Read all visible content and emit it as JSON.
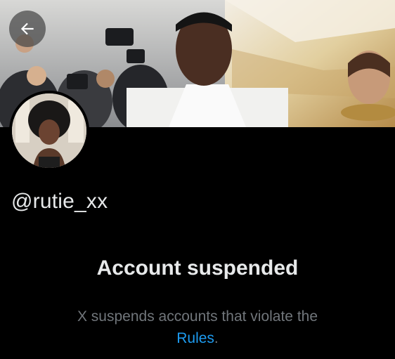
{
  "banner": {
    "description_icon": "event-photo-banner"
  },
  "back_button": {
    "icon": "arrow-left-icon"
  },
  "profile": {
    "avatar_icon": "avatar",
    "handle": "@rutie_xx"
  },
  "suspension": {
    "title": "Account suspended",
    "message": "X suspends accounts that violate the",
    "rules_link": "Rules",
    "period": "."
  },
  "colors": {
    "background": "#000000",
    "primary_text": "#e7e9ea",
    "secondary_text": "#71767b",
    "link": "#1d9bf0"
  }
}
